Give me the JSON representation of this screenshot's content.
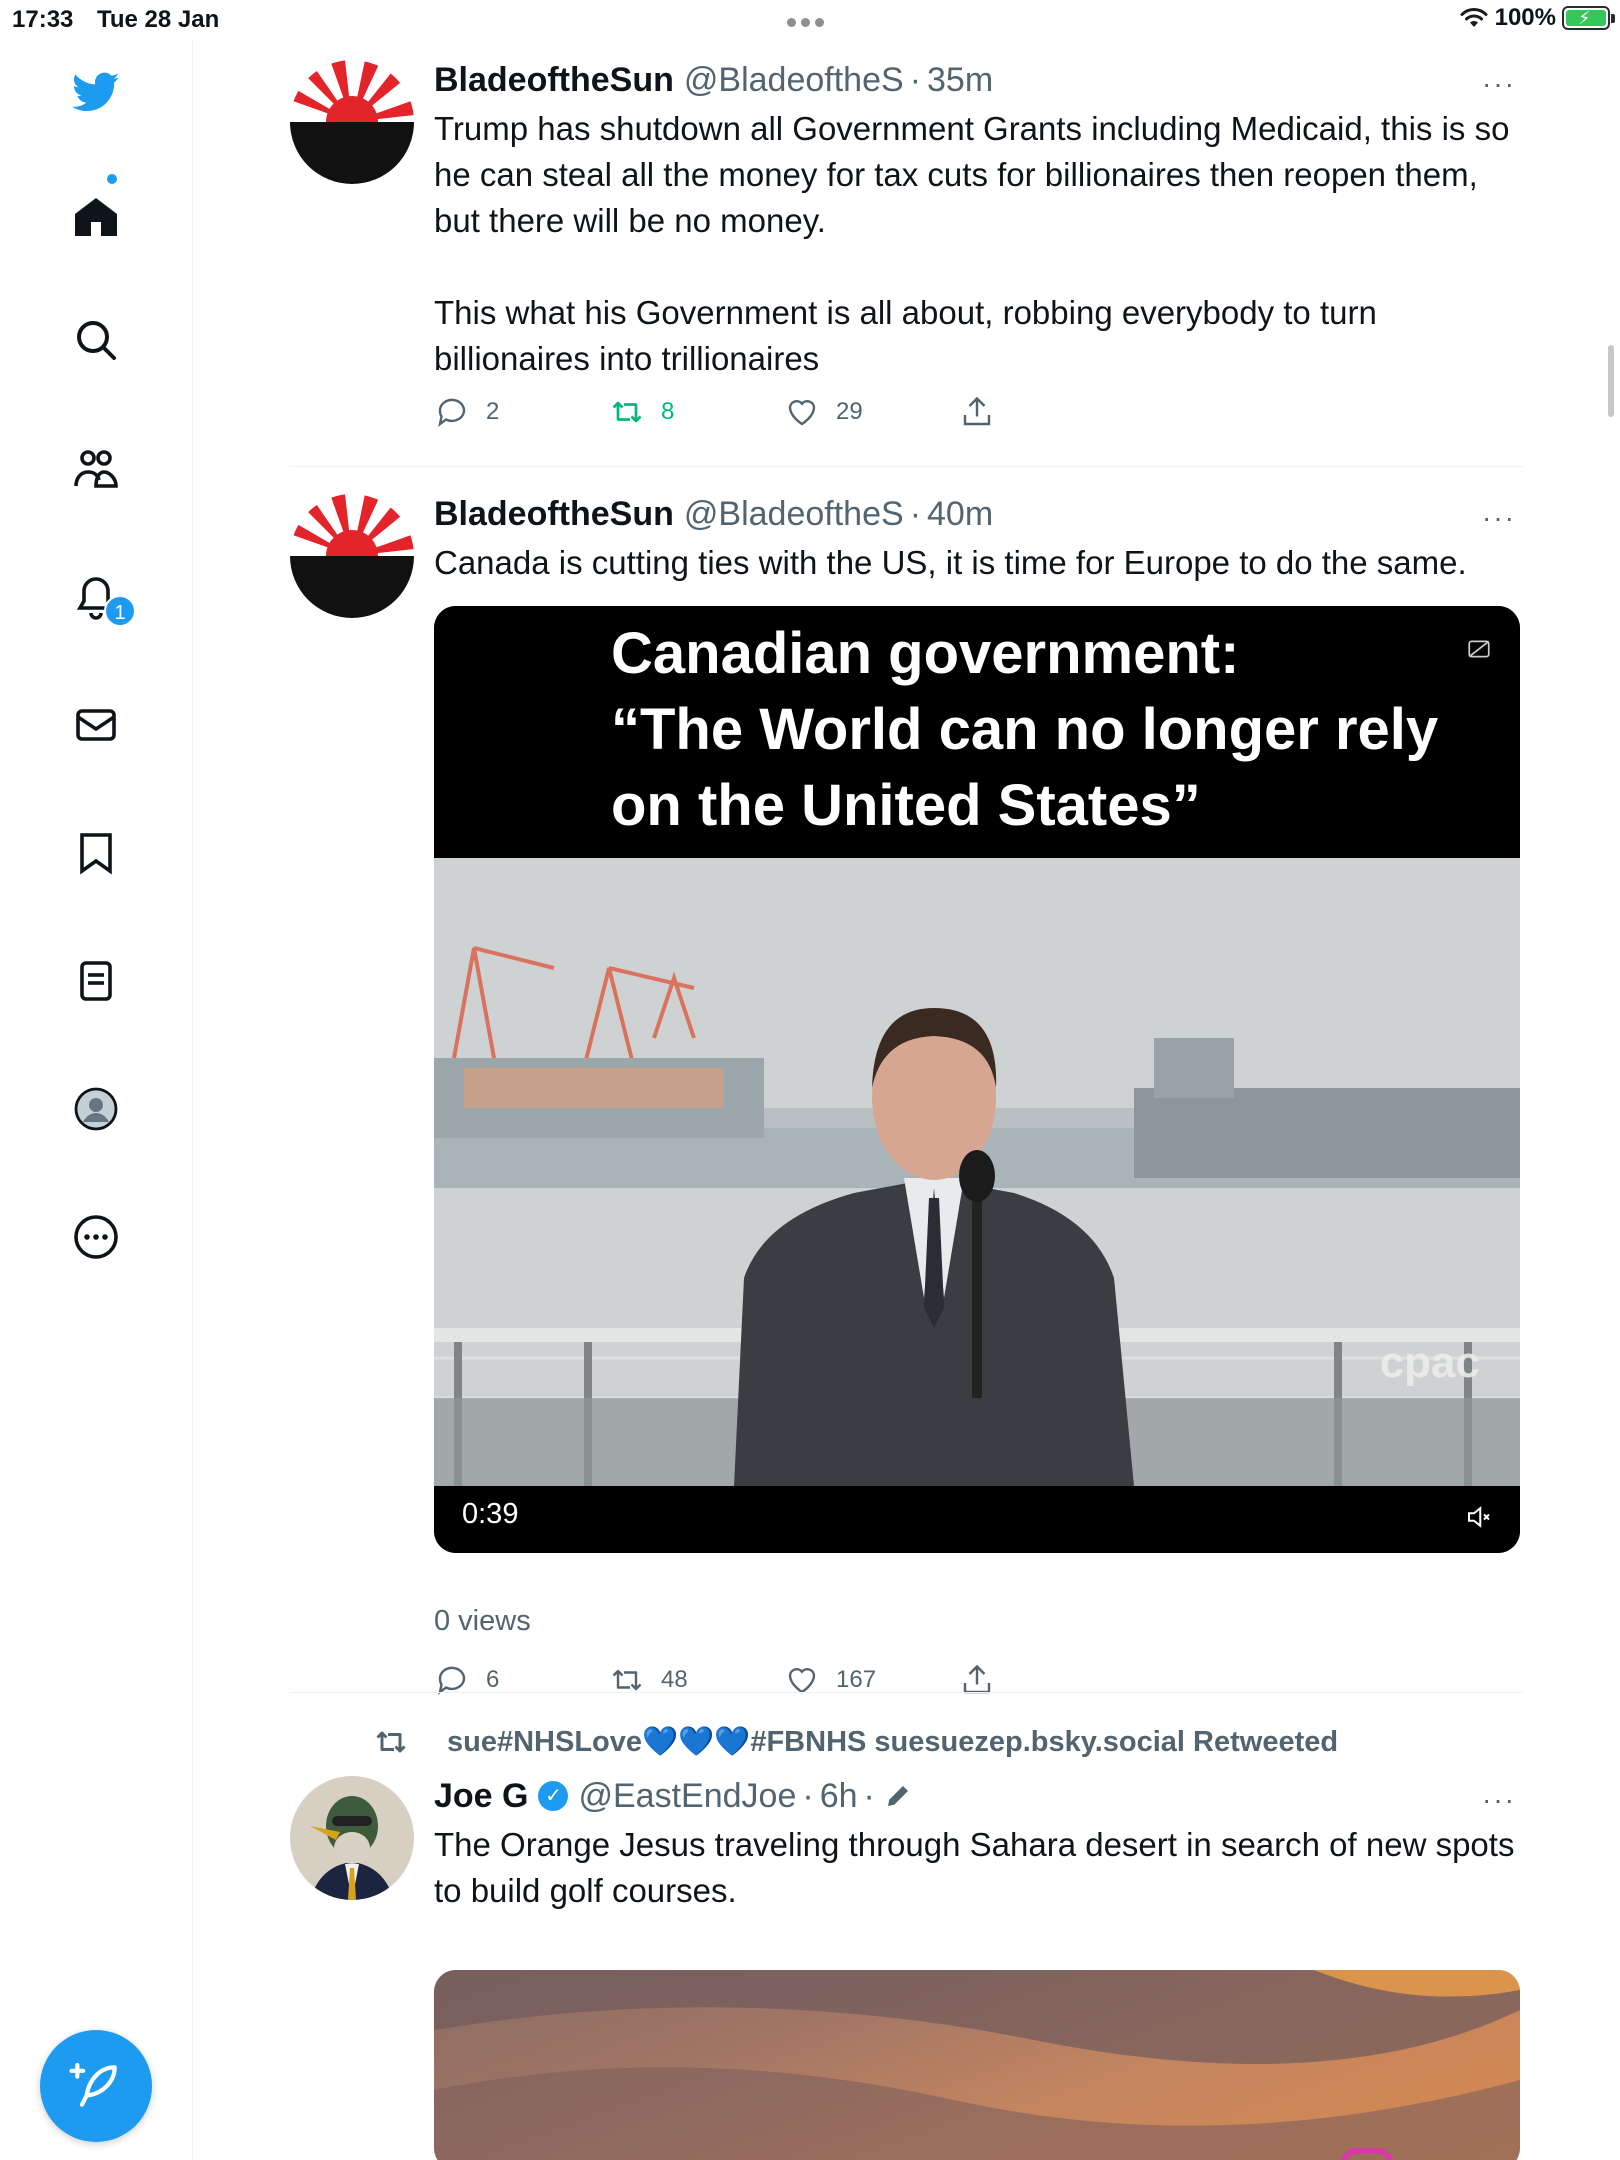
{
  "status_bar": {
    "time": "17:33",
    "date": "Tue 28 Jan",
    "battery": "100%"
  },
  "sidebar": {
    "items": [
      {
        "name": "twitter-logo-icon"
      },
      {
        "name": "home-icon"
      },
      {
        "name": "search-icon"
      },
      {
        "name": "communities-icon"
      },
      {
        "name": "notifications-icon",
        "badge": "1"
      },
      {
        "name": "messages-icon"
      },
      {
        "name": "bookmarks-icon"
      },
      {
        "name": "lists-icon"
      },
      {
        "name": "profile-icon"
      },
      {
        "name": "more-icon"
      }
    ],
    "accent": "#1d9bf0"
  },
  "tweets": [
    {
      "name": "BladeoftheSun",
      "handle": "@BladeoftheS",
      "time": "35m",
      "text_1": "Trump has shutdown all Government Grants including Medicaid, this is so he can steal all the money for tax cuts for billionaires then reopen them, but there will be no money.",
      "text_2": "This what his Government is all about, robbing everybody to turn billionaires into trillionaires",
      "replies": "2",
      "retweets": "8",
      "likes": "29"
    },
    {
      "name": "BladeoftheSun",
      "handle": "@BladeoftheS",
      "time": "40m",
      "text_1": "Canada is cutting ties with the US, it is time for Europe to do the same.",
      "video_caption": "Canadian government:\n“The World can no longer rely on the United States”",
      "video_watermark": "cpac",
      "duration": "0:39",
      "views": "0 views",
      "replies": "6",
      "retweets": "48",
      "likes": "167"
    },
    {
      "retweeted_by": "sue#NHSLove",
      "retweeted_by_suffix": "#FBNHS suesuezep.bsky.social Retweeted",
      "name": "Joe G",
      "handle": "@EastEndJoe",
      "time": "6h",
      "text_1": "The Orange Jesus traveling through Sahara desert in search of new spots to build golf courses."
    }
  ]
}
